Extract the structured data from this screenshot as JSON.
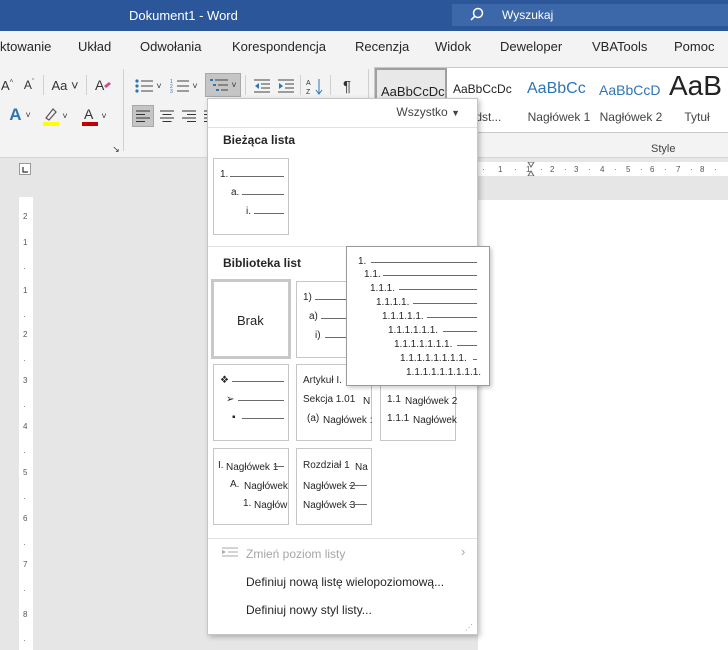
{
  "window": {
    "title": "Dokument1  -  Word",
    "search_placeholder": "Wyszukaj"
  },
  "tabs": [
    "ktowanie",
    "Układ",
    "Odwołania",
    "Korespondencja",
    "Recenzja",
    "Widok",
    "Deweloper",
    "VBATools",
    "Pomoc"
  ],
  "ribbon": {
    "styles_group_label": "Style",
    "styles": [
      {
        "preview": "AaBbCcDc",
        "name": ""
      },
      {
        "preview": "AaBbCcDc",
        "name": "odst..."
      },
      {
        "preview": "AaBbCc",
        "name": "Nagłówek 1"
      },
      {
        "preview": "AaBbCcD",
        "name": "Nagłówek 2"
      },
      {
        "preview": "AaB",
        "name": "Tytuł"
      }
    ]
  },
  "dropdown": {
    "filter": "Wszystko",
    "current_header": "Bieżąca lista",
    "library_header": "Biblioteka list",
    "current_list": [
      "1.",
      "a.",
      "i."
    ],
    "none_label": "Brak",
    "cell_numeric": [
      "1)",
      "a)",
      "i)"
    ],
    "cell_bullets": [
      "❖",
      "➢",
      "▪"
    ],
    "cell_articles": {
      "l1": "Artykuł I.",
      "l2": "Sekcja 1.01",
      "l3": "(a)",
      "h1": "N",
      "h2": "N",
      "h3": "Nagłówek :"
    },
    "cell_decimal_headings": {
      "l1": "1",
      "l2": "1.1",
      "l3": "1.1.1",
      "g1": "Nagłówek 1",
      "g2": "Nagłówek 2",
      "g3": "Nagłówek"
    },
    "cell_roman_headings": {
      "l1": "I.",
      "l2": "A.",
      "l3": "1.",
      "g1": "Nagłówek 1",
      "g2": "Nagłówek",
      "g3": "Nagłów"
    },
    "cell_chapter": {
      "l1": "Rozdział 1",
      "g1": "Na",
      "g2": "Nagłówek 2",
      "g3": "Nagłówek 3"
    },
    "menu": {
      "change_level": "Zmień poziom listy",
      "define_multilevel": "Definiuj nową listę wielopoziomową...",
      "define_style": "Definiuj nowy styl listy..."
    }
  },
  "preview_popup": [
    "1.",
    "1.1.",
    "1.1.1.",
    "1.1.1.1.",
    "1.1.1.1.1.",
    "1.1.1.1.1.1.",
    "1.1.1.1.1.1.1.",
    "1.1.1.1.1.1.1.1.",
    "1.1.1.1.1.1.1.1.1."
  ],
  "colors": {
    "titlebar": "#2b579a",
    "highlight": "#ffff00",
    "font_color": "#c00000",
    "text_effects": "#2e75b6"
  }
}
